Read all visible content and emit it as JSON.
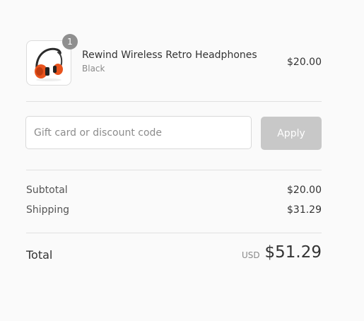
{
  "cart": {
    "item": {
      "image_alt": "Rewind Wireless Retro Headphones",
      "quantity": "1",
      "name": "Rewind Wireless Retro Headphones",
      "variant": "Black",
      "price": "$20.00"
    }
  },
  "discount": {
    "placeholder": "Gift card or discount code",
    "value": "",
    "apply_label": "Apply"
  },
  "totals": {
    "subtotal_label": "Subtotal",
    "subtotal_value": "$20.00",
    "shipping_label": "Shipping",
    "shipping_value": "$31.29",
    "total_label": "Total",
    "currency": "USD",
    "total_value": "$51.29"
  },
  "colors": {
    "apply_button_disabled": "#c8c8c8",
    "quantity_badge": "#8f8f8f",
    "headphone_orange": "#e8531d"
  },
  "icons": {
    "product_image": "headphones-image"
  }
}
